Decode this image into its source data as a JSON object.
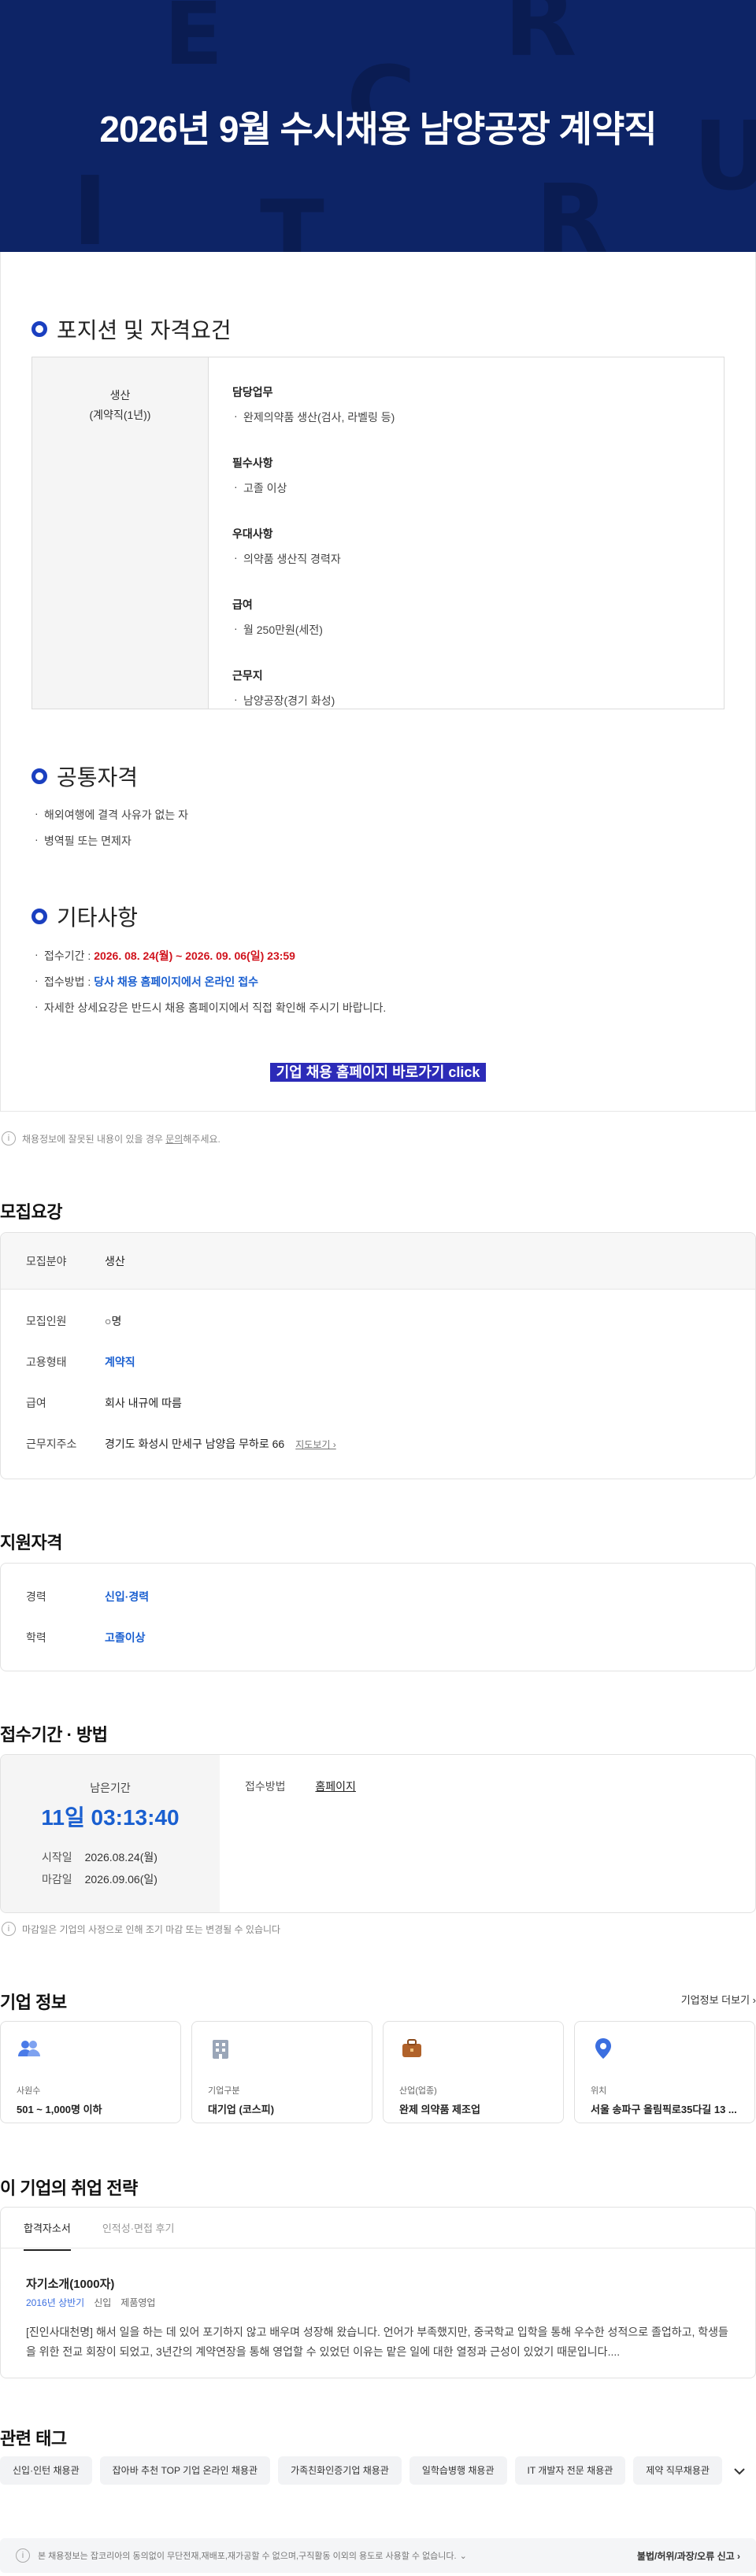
{
  "hero": {
    "title": "2026년 9월 수시채용 남양공장 계약직",
    "deco_letters": [
      "E",
      "R",
      "C",
      "U",
      "I",
      "T",
      "R"
    ]
  },
  "position": {
    "section_title": "포지션 및 자격요건",
    "job_name": "생산",
    "job_type": "(계약직(1년))",
    "requirements": [
      {
        "title": "담당업무",
        "items": [
          "완제의약품 생산(검사, 라벨링 등)"
        ]
      },
      {
        "title": "필수사항",
        "items": [
          "고졸 이상"
        ]
      },
      {
        "title": "우대사항",
        "items": [
          "의약품 생산직 경력자"
        ]
      },
      {
        "title": "급여",
        "items": [
          "월 250만원(세전)"
        ]
      },
      {
        "title": "근무지",
        "items": [
          "남양공장(경기 화성)"
        ]
      }
    ]
  },
  "common": {
    "section_title": "공통자격",
    "items": [
      "해외여행에 결격 사유가 없는 자",
      "병역필 또는 면제자"
    ]
  },
  "etc": {
    "section_title": "기타사항",
    "period_label": "접수기간 : ",
    "period_value": "2026. 08. 24(월) ~ 2026. 09. 06(일) 23:59",
    "method_label": "접수방법 : ",
    "method_value": "당사 채용 홈페이지에서 온라인 접수",
    "detail": "자세한 상세요강은 반드시 채용 홈페이지에서 직접 확인해 주시기 바랍니다."
  },
  "cta_label": "기업 채용 홈페이지 바로가기 click",
  "report_note": {
    "prefix": "채용정보에 잘못된 내용이 있을 경우 ",
    "link": "문의",
    "suffix": "해주세요."
  },
  "recruit": {
    "title": "모집요강",
    "field_label": "모집분야",
    "field_value": "생산",
    "rows": [
      {
        "k": "모집인원",
        "v": "○명"
      },
      {
        "k": "고용형태",
        "v": "계약직"
      },
      {
        "k": "급여",
        "v": "회사 내규에 따름"
      },
      {
        "k": "근무지주소",
        "v": "경기도 화성시 만세구 남양읍 무하로 66"
      }
    ],
    "map_link": "지도보기 ›"
  },
  "qualification": {
    "title": "지원자격",
    "rows": [
      {
        "k": "경력",
        "v": "신입·경력"
      },
      {
        "k": "학력",
        "v": "고졸이상"
      }
    ]
  },
  "period": {
    "title": "접수기간 · 방법",
    "remain_label": "남은기간",
    "remain_time": "11일 03:13:40",
    "start_label": "시작일",
    "start_value": "2026.08.24(월)",
    "end_label": "마감일",
    "end_value": "2026.09.06(일)",
    "method_label": "접수방법",
    "method_value": "홈페이지",
    "note": "마감일은 기업의 사정으로 인해 조기 마감 또는 변경될 수 있습니다"
  },
  "company": {
    "title": "기업 정보",
    "more": "기업정보 더보기 ›",
    "cards": [
      {
        "icon": "people-icon",
        "label": "사원수",
        "value": "501 ~ 1,000명 이하"
      },
      {
        "icon": "building-icon",
        "label": "기업구분",
        "value": "대기업 (코스피)"
      },
      {
        "icon": "briefcase-icon",
        "label": "산업(업종)",
        "value": "완제 의약품 제조업"
      },
      {
        "icon": "location-pin-icon",
        "label": "위치",
        "value": "서울 송파구 올림픽로35다길 13 ..."
      }
    ],
    "accent": "#4a7be8"
  },
  "strategy": {
    "title": "이 기업의 취업 전략",
    "tabs": [
      "합격자소서",
      "인적성·면접 후기"
    ],
    "essay_title": "자기소개(1000자)",
    "essay_meta": [
      "2016년 상반기",
      "신입",
      "제품영업"
    ],
    "essay_body": "[진인사대천명] 해서 일을 하는 데 있어 포기하지 않고 배우며 성장해 왔습니다. 언어가 부족했지만, 중국학교 입학을 통해 우수한 성적으로 졸업하고, 학생들을 위한 전교 회장이 되었고, 3년간의 계약연장을 통해 영업할 수 있었던 이유는 맡은 일에 대한 열정과 근성이 있었기 때문입니다...."
  },
  "tags": {
    "title": "관련 태그",
    "items": [
      "신입·인턴 채용관",
      "잡아바 추천 TOP 기업 온라인 채용관",
      "가족친화인증기업 채용관",
      "일학습병행 채용관",
      "IT 개발자 전문 채용관",
      "제약 직무채용관"
    ]
  },
  "footer": {
    "notice": "본 채용정보는 잡코리아의 동의없이 무단전재,재배포,재가공할 수 없으며,구직활동 이외의 용도로 사용할 수 없습니다.",
    "report": "불법/허위/과장/오류 신고 ›"
  },
  "colors": {
    "hero_bg": "#0d2466",
    "accent_blue": "#1a5fd0",
    "red": "#d0121c",
    "cta_bg": "#2c2bb8"
  }
}
